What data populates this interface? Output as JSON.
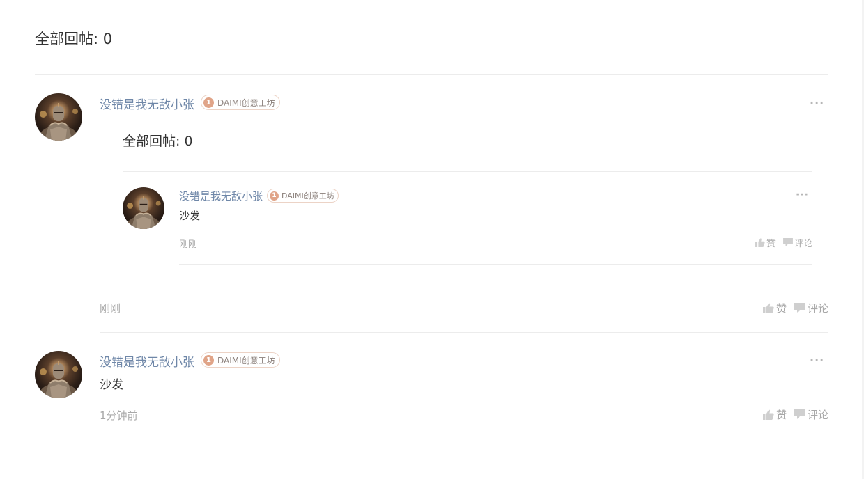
{
  "header": {
    "title": "全部回帖: 0"
  },
  "posts": [
    {
      "username": "没错是我无敌小张",
      "badge_level": "1",
      "badge_text": "DAIMI创意工坊",
      "nested_title": "全部回帖: 0",
      "time": "刚刚",
      "like_label": "赞",
      "comment_label": "评论",
      "reply": {
        "username": "没错是我无敌小张",
        "badge_level": "1",
        "badge_text": "DAIMI创意工坊",
        "content": "沙发",
        "time": "刚刚",
        "like_label": "赞",
        "comment_label": "评论"
      }
    },
    {
      "username": "没错是我无敌小张",
      "badge_level": "1",
      "badge_text": "DAIMI创意工坊",
      "content": "沙发",
      "time": "1分钟前",
      "like_label": "赞",
      "comment_label": "评论"
    }
  ],
  "icons": {
    "more": "more-dots-icon",
    "like": "thumbs-up-icon",
    "comment": "comment-bubble-icon",
    "avatar": "knight-avatar"
  },
  "colors": {
    "username": "#6f87a8",
    "badge_border": "#ecd3c6",
    "badge_level_bg": "#e0a488",
    "muted": "#a8a8a8",
    "divider": "#ececec"
  }
}
